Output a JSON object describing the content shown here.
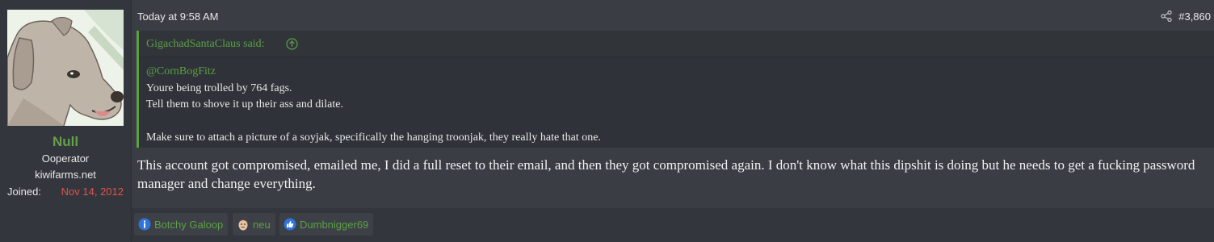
{
  "user": {
    "name": "Null",
    "title": "Ooperator",
    "site": "kiwifarms.net",
    "joined_label": "Joined:",
    "joined_date": "Nov 14, 2012",
    "avatar_icon": "dog-avatar"
  },
  "post": {
    "timestamp": "Today at 9:58 AM",
    "number": "#3,860",
    "share_icon": "share-icon",
    "quote": {
      "author": "GigachadSantaClaus said:",
      "arrow_icon": "arrow-up-circle-icon",
      "mention": "@CornBogFitz",
      "line1": "Youre being trolled by 764 fags.",
      "line2": "Tell them to shove it up their ass and dilate.",
      "line3": "Make sure to attach a picture of a soyjak, specifically the hanging troonjak, they really hate that one."
    },
    "message": "This account got compromised, emailed me, I did a full reset to their email, and then they got compromised again. I don't know what this dipshit is doing but he needs to get a fucking password manager and change everything."
  },
  "reactions": [
    {
      "icon": "info-icon",
      "label": "Botchy Galoop"
    },
    {
      "icon": "face-icon",
      "label": "neu"
    },
    {
      "icon": "thumbs-up-icon",
      "label": "Dumbnigger69"
    }
  ],
  "colors": {
    "accent_green": "#5ba043",
    "date_red": "#e0544a",
    "background": "#3a3d44"
  }
}
